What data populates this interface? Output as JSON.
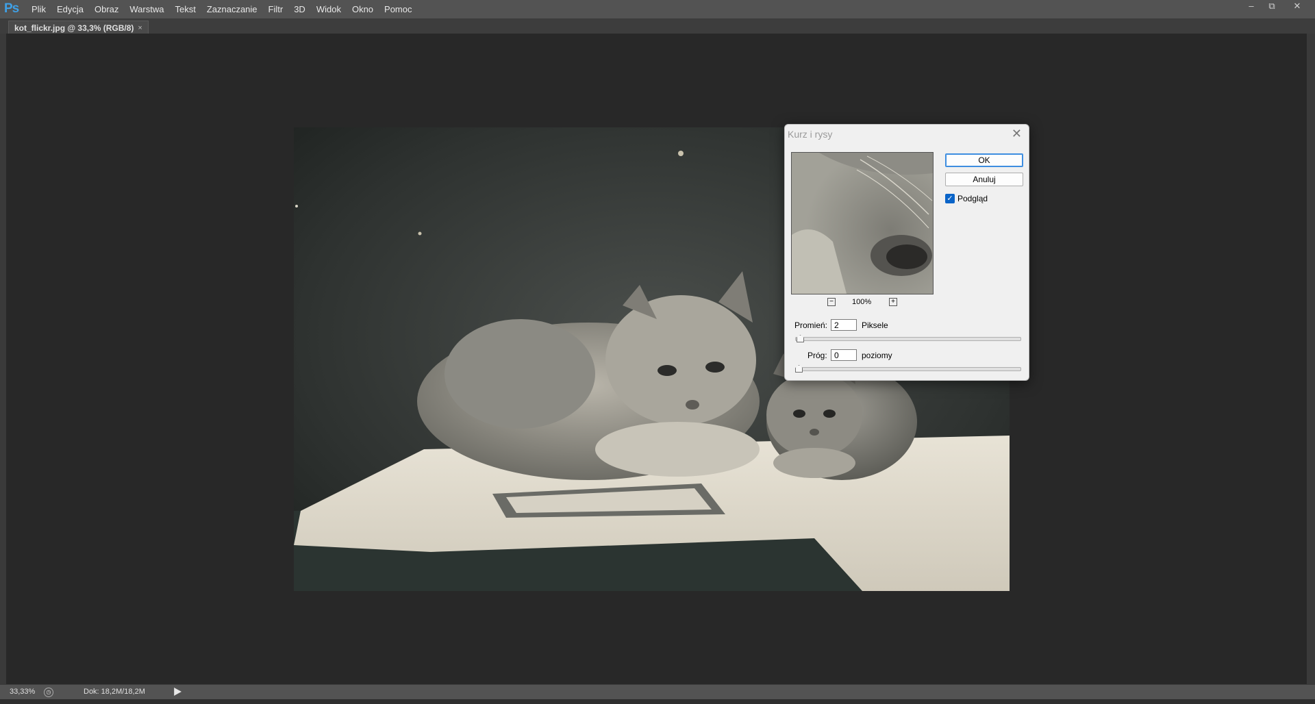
{
  "app": {
    "logo_text": "Ps"
  },
  "menu": [
    "Plik",
    "Edycja",
    "Obraz",
    "Warstwa",
    "Tekst",
    "Zaznaczanie",
    "Filtr",
    "3D",
    "Widok",
    "Okno",
    "Pomoc"
  ],
  "window_controls": {
    "minimize": "–",
    "restore": "⧉",
    "close": "✕"
  },
  "document": {
    "tab_title": "kot_flickr.jpg @ 33,3% (RGB/8)",
    "tab_close": "×"
  },
  "status": {
    "zoom": "33,33%",
    "doc_size": "Dok: 18,2M/18,2M"
  },
  "dialog": {
    "title": "Kurz i rysy",
    "close": "✕",
    "preview_zoom": "100%",
    "zoom_out": "−",
    "zoom_in": "+",
    "ok_label": "OK",
    "cancel_label": "Anuluj",
    "preview_label": "Podgląd",
    "preview_checked": true,
    "radius_label": "Promień:",
    "radius_value": "2",
    "radius_unit": "Piksele",
    "threshold_label": "Próg:",
    "threshold_value": "0",
    "threshold_unit": "poziomy"
  }
}
